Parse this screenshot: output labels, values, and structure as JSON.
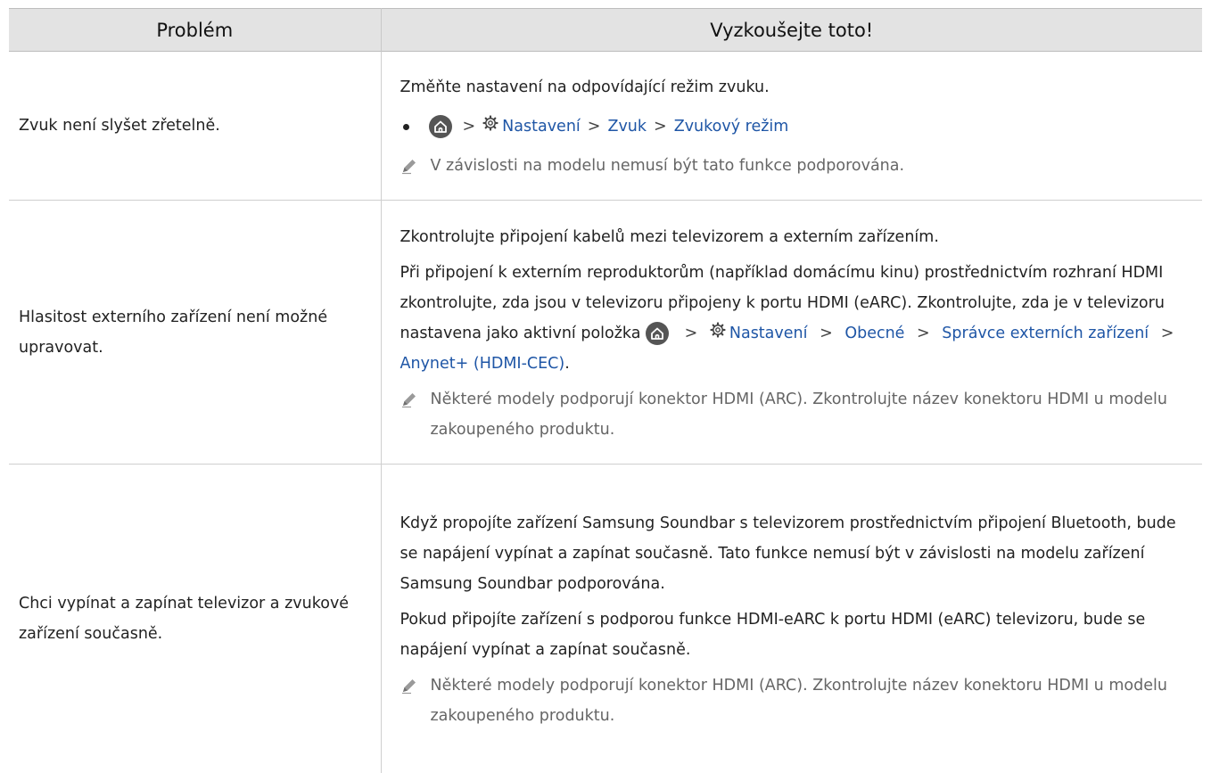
{
  "table": {
    "headers": {
      "problem": "Problém",
      "solution": "Vyzkoušejte toto!"
    },
    "rows": [
      {
        "problem": "Zvuk není slyšet zřetelně.",
        "intro": "Změňte nastavení na odpovídající režim zvuku.",
        "path": [
          "Nastavení",
          "Zvuk",
          "Zvukový režim"
        ],
        "note": "V závislosti na modelu nemusí být tato funkce podporována."
      },
      {
        "problem": "Hlasitost externího zařízení není možné upravovat.",
        "p1": "Zkontrolujte připojení kabelů mezi televizorem a externím zařízením.",
        "p2_text": "Při připojení k externím reproduktorům (například domácímu kinu) prostřednictvím rozhraní HDMI zkontrolujte, zda jsou v televizoru připojeny k portu HDMI (eARC). Zkontrolujte, zda je v televizoru nastavena jako aktivní položka",
        "path": [
          "Nastavení",
          "Obecné",
          "Správce externích zařízení",
          "Anynet+ (HDMI-CEC)"
        ],
        "p2_end": ".",
        "note": "Některé modely podporují konektor HDMI (ARC). Zkontrolujte název konektoru HDMI u modelu zakoupeného produktu."
      },
      {
        "problem": "Chci vypínat a zapínat televizor a zvukové zařízení současně.",
        "p1": "Když propojíte zařízení Samsung Soundbar s televizorem prostřednictvím připojení Bluetooth, bude se napájení vypínat a zapínat současně. Tato funkce nemusí být v závislosti na modelu zařízení Samsung Soundbar podporována.",
        "p2": "Pokud připojíte zařízení s podporou funkce HDMI-eARC k portu HDMI (eARC) televizoru, bude se napájení vypínat a zapínat současně.",
        "note": "Některé modely podporují konektor HDMI (ARC). Zkontrolujte název konektoru HDMI u modelu zakoupeného produktu."
      }
    ]
  },
  "path_separator": ">",
  "icons": [
    "home-icon",
    "gear-icon",
    "pencil-note-icon"
  ],
  "colors": {
    "link": "#1f56a6",
    "header_bg": "#e3e3e3",
    "note_text": "#666666"
  }
}
